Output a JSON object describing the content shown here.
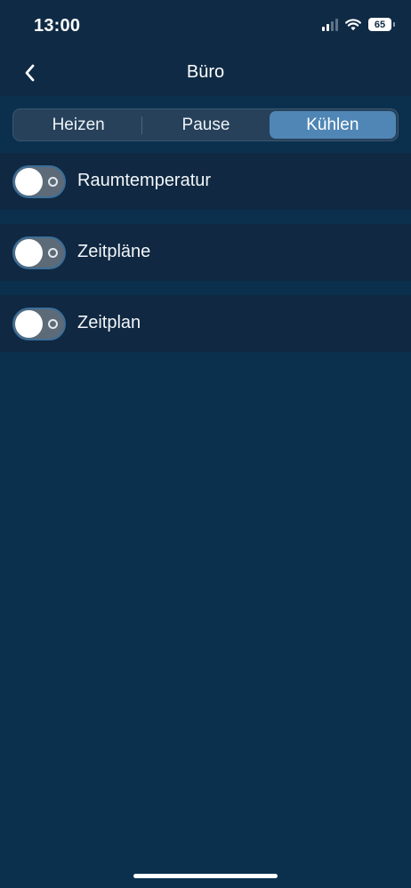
{
  "status_bar": {
    "time": "13:00",
    "battery": "65"
  },
  "nav": {
    "title": "Büro",
    "back_icon": "chevron-left-icon"
  },
  "mode_control": {
    "segments": [
      {
        "label": "Heizen",
        "selected": false
      },
      {
        "label": "Pause",
        "selected": false
      },
      {
        "label": "Kühlen",
        "selected": true
      }
    ]
  },
  "settings": [
    {
      "label": "Raumtemperatur",
      "enabled": false
    },
    {
      "label": "Zeitpläne",
      "enabled": false
    },
    {
      "label": "Zeitplan",
      "enabled": false
    }
  ],
  "colors": {
    "background": "#0b304e",
    "row_background": "#102841",
    "header_background": "#0f2a44",
    "accent": "#4f86b5"
  }
}
